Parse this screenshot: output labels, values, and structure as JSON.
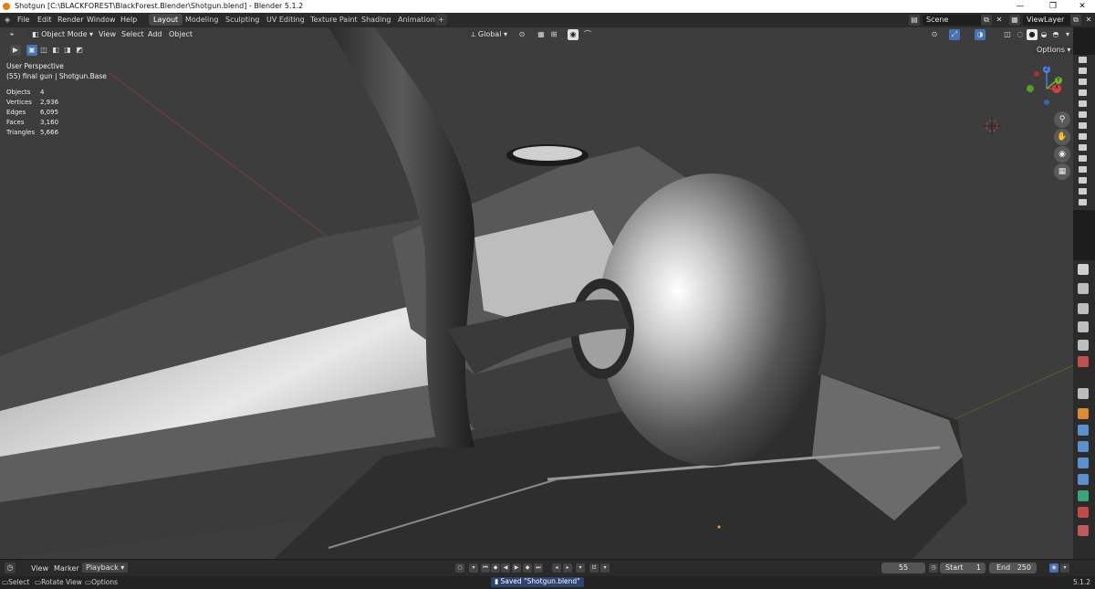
{
  "window": {
    "title": "Shotgun [C:\\BLACKFOREST\\BlackForest.Blender\\Shotgun.blend] - Blender 5.1.2",
    "minimize": "—",
    "maximize": "❐",
    "close": "✕"
  },
  "menu": [
    "File",
    "Edit",
    "Render",
    "Window",
    "Help"
  ],
  "workspaces": [
    "Layout",
    "Modeling",
    "Sculpting",
    "UV Editing",
    "Texture Paint",
    "Shading",
    "Animation"
  ],
  "workspace_add": "+",
  "scene": {
    "label": "Scene",
    "viewlayer": "ViewLayer"
  },
  "viewport_header": {
    "mode": "Object Mode",
    "menus": [
      "View",
      "Select",
      "Add",
      "Object"
    ],
    "orientation": "Global",
    "options": "Options"
  },
  "overlay": {
    "perspective": "User Perspective",
    "object": "(55) final gun | Shotgun.Base",
    "stats": [
      {
        "label": "Objects",
        "value": "4"
      },
      {
        "label": "Vertices",
        "value": "2,936"
      },
      {
        "label": "Edges",
        "value": "6,095"
      },
      {
        "label": "Faces",
        "value": "3,160"
      },
      {
        "label": "Triangles",
        "value": "5,666"
      }
    ]
  },
  "gizmo": {
    "x": "X",
    "y": "Y",
    "z": "Z"
  },
  "timeline": {
    "menus": [
      "View",
      "Marker"
    ],
    "playback": "Playback",
    "current_frame": "55",
    "start_label": "Start",
    "start": "1",
    "end_label": "End",
    "end": "250"
  },
  "statusbar": {
    "select": "Select",
    "rotate": "Rotate View",
    "options": "Options",
    "message": "Saved \"Shotgun.blend\"",
    "version": "5.1.2"
  },
  "colors": {
    "accent": "#4772b3",
    "active_tab": "#484848",
    "viewport_bg": "#3d3d3d",
    "blender_orange": "#e87d0d"
  }
}
